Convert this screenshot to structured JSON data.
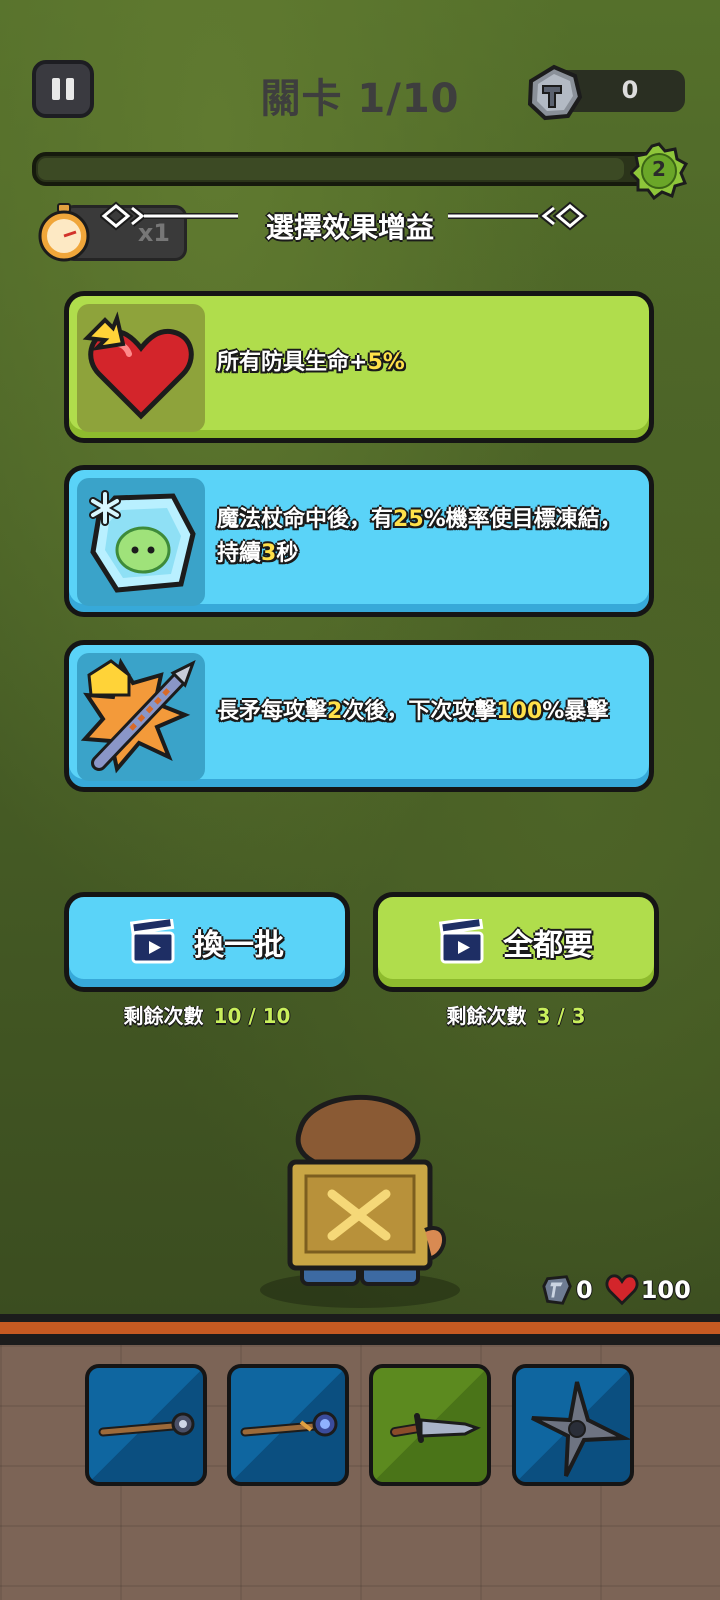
{
  "hud": {
    "level_title": "關卡 1/10",
    "coin_count": "0",
    "wave_number": "2",
    "speed_label": "x1"
  },
  "selection": {
    "header": "選擇效果增益",
    "cards": [
      {
        "theme": "green",
        "icon": "heart-icon",
        "segments": [
          {
            "text": "所有防具生命+",
            "highlight": false
          },
          {
            "text": "5%",
            "highlight": true
          }
        ]
      },
      {
        "theme": "blue",
        "icon": "frozen-slime-icon",
        "segments": [
          {
            "text": "魔法杖命中後，有",
            "highlight": false
          },
          {
            "text": "25",
            "highlight": true
          },
          {
            "text": "%機率使目標凍結，持續",
            "highlight": false
          },
          {
            "text": "3",
            "highlight": true
          },
          {
            "text": "秒",
            "highlight": false
          }
        ]
      },
      {
        "theme": "blue",
        "icon": "spear-crit-icon",
        "segments": [
          {
            "text": "長矛每攻擊",
            "highlight": false
          },
          {
            "text": "2",
            "highlight": true
          },
          {
            "text": "次後，下次攻擊",
            "highlight": false
          },
          {
            "text": "100",
            "highlight": true
          },
          {
            "text": "%暴擊",
            "highlight": false
          }
        ]
      }
    ]
  },
  "actions": {
    "refresh": {
      "label": "換一批",
      "remaining_label": "剩餘次數",
      "remaining": "10 / 10"
    },
    "take_all": {
      "label": "全都要",
      "remaining_label": "剩餘次數",
      "remaining": "3 / 3"
    }
  },
  "player": {
    "shield": "0",
    "health": "100"
  },
  "weapons": [
    {
      "name": "staff-1-icon",
      "theme": "blue"
    },
    {
      "name": "staff-2-icon",
      "theme": "blue"
    },
    {
      "name": "dagger-icon",
      "theme": "green"
    },
    {
      "name": "shuriken-icon",
      "theme": "blue"
    }
  ],
  "colors": {
    "green_card": "#b0dd4c",
    "blue_card": "#5ad3f8",
    "highlight": "#ffe04a",
    "count_green": "#c9ef5c"
  }
}
